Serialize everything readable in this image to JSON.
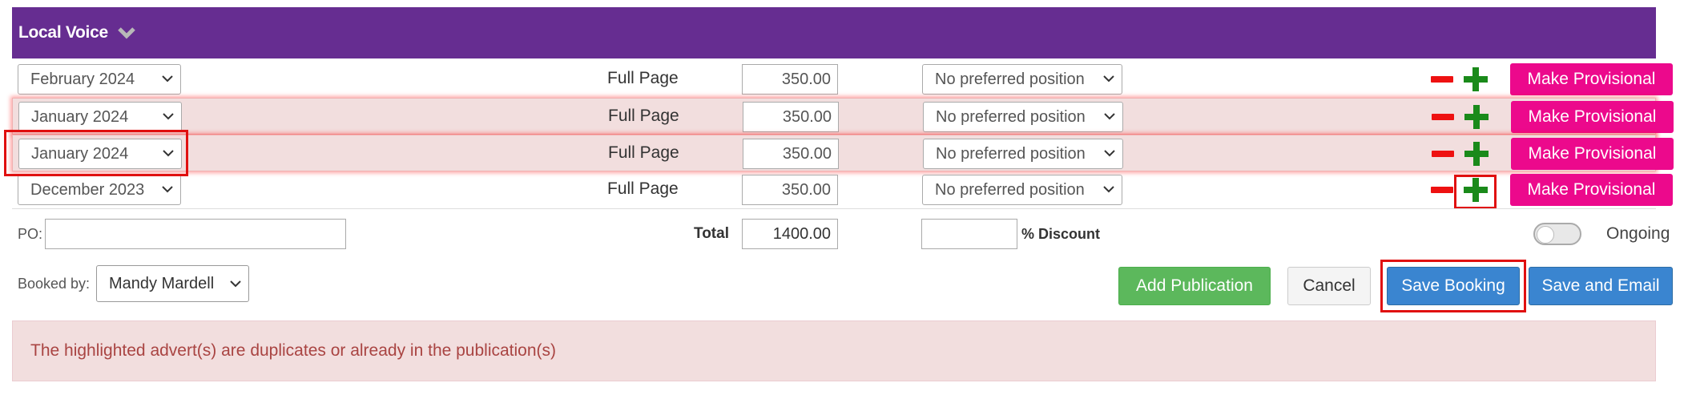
{
  "header": {
    "title": "Local Voice"
  },
  "rows": [
    {
      "month": "February 2024",
      "ad_size": "Full Page",
      "price": "350.00",
      "position": "No preferred position",
      "provisional_label": "Make Provisional"
    },
    {
      "month": "January 2024",
      "ad_size": "Full Page",
      "price": "350.00",
      "position": "No preferred position",
      "provisional_label": "Make Provisional"
    },
    {
      "month": "January 2024",
      "ad_size": "Full Page",
      "price": "350.00",
      "position": "No preferred position",
      "provisional_label": "Make Provisional"
    },
    {
      "month": "December 2023",
      "ad_size": "Full Page",
      "price": "350.00",
      "position": "No preferred position",
      "provisional_label": "Make Provisional"
    }
  ],
  "footer": {
    "po_label": "PO:",
    "po_value": "",
    "total_label": "Total",
    "total_value": "1400.00",
    "discount_value": "",
    "discount_label": "% Discount",
    "ongoing_label": "Ongoing",
    "ongoing_on": false,
    "booked_by_label": "Booked by:",
    "booked_by_value": "Mandy Mardell"
  },
  "buttons": {
    "add_publication": "Add Publication",
    "cancel": "Cancel",
    "save_booking": "Save Booking",
    "save_and_email": "Save and Email"
  },
  "alert": {
    "message": "The highlighted advert(s) are duplicates or already in the publication(s)"
  },
  "colors": {
    "header_bg": "#662d91",
    "provisional_btn": "#ec098c",
    "add_btn": "#5cb85c",
    "save_btn": "#3a85d0",
    "duplicate_row_bg": "#f2dede",
    "alert_text": "#a94442"
  }
}
